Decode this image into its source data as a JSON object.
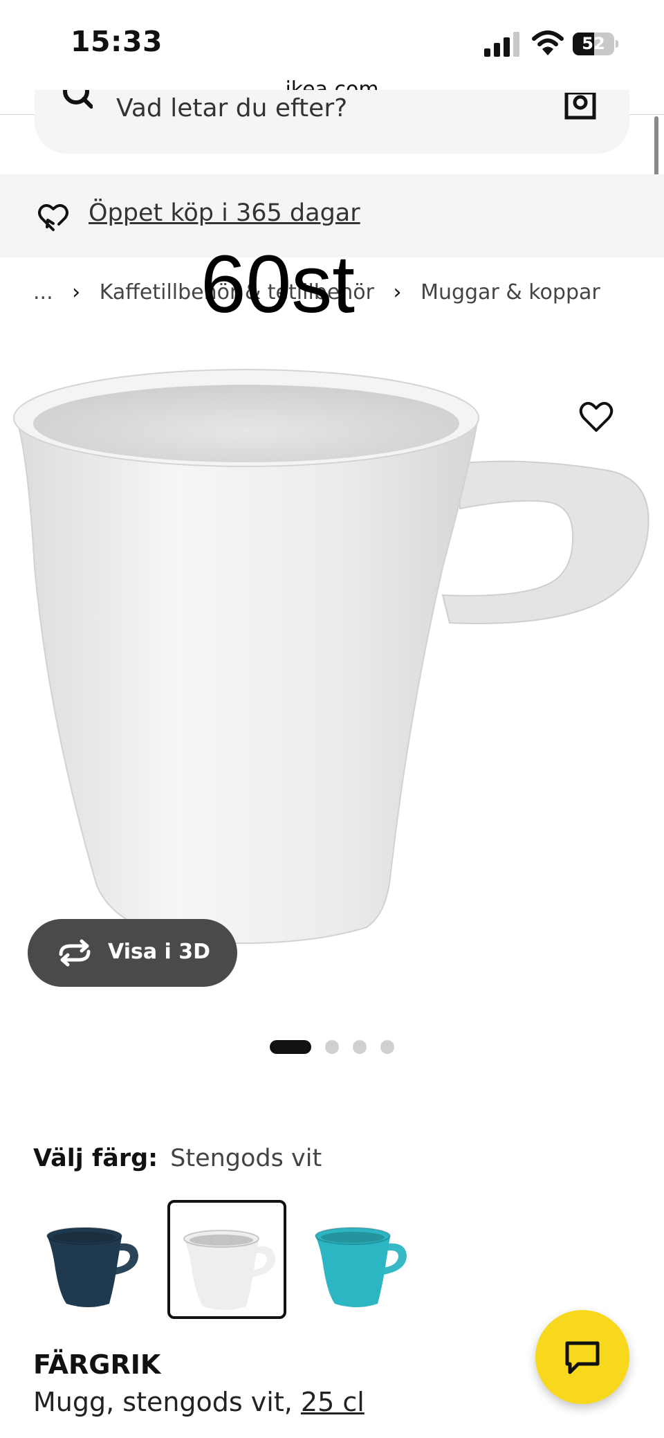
{
  "status_bar": {
    "time": "15:33",
    "battery": "52",
    "battery_level_percent": 52,
    "signal_bars": 3,
    "url": "ikea.com"
  },
  "search": {
    "placeholder": "Vad letar du efter?",
    "icon": "search-icon",
    "camera_icon": "camera-icon"
  },
  "banner": {
    "text": "Öppet köp i 365 dagar",
    "icon": "return-heart-icon"
  },
  "breadcrumb": {
    "ellipsis": "...",
    "items": [
      "Kaffetillbehör & tetillbehör",
      "Muggar & koppar"
    ]
  },
  "overlay_text": "60st",
  "product_image": {
    "view_3d_label": "Visa i 3D",
    "carousel_count": 4,
    "carousel_active": 1
  },
  "color": {
    "label": "Välj färg:",
    "selected": "Stengods vit",
    "swatches": [
      {
        "name": "dark-blue",
        "color": "#1f3a4f"
      },
      {
        "name": "white",
        "color": "#eeeeee"
      },
      {
        "name": "turquoise",
        "color": "#2cb5c2"
      }
    ],
    "selected_index": 1
  },
  "product": {
    "name": "FÄRGRIK",
    "desc": "Mugg, stengods vit, ",
    "size": "25 cl"
  },
  "colors": {
    "chat_button": "#f8d81c",
    "view_3d_bg": "#4a4a4a",
    "banner_bg": "#f5f5f5"
  }
}
